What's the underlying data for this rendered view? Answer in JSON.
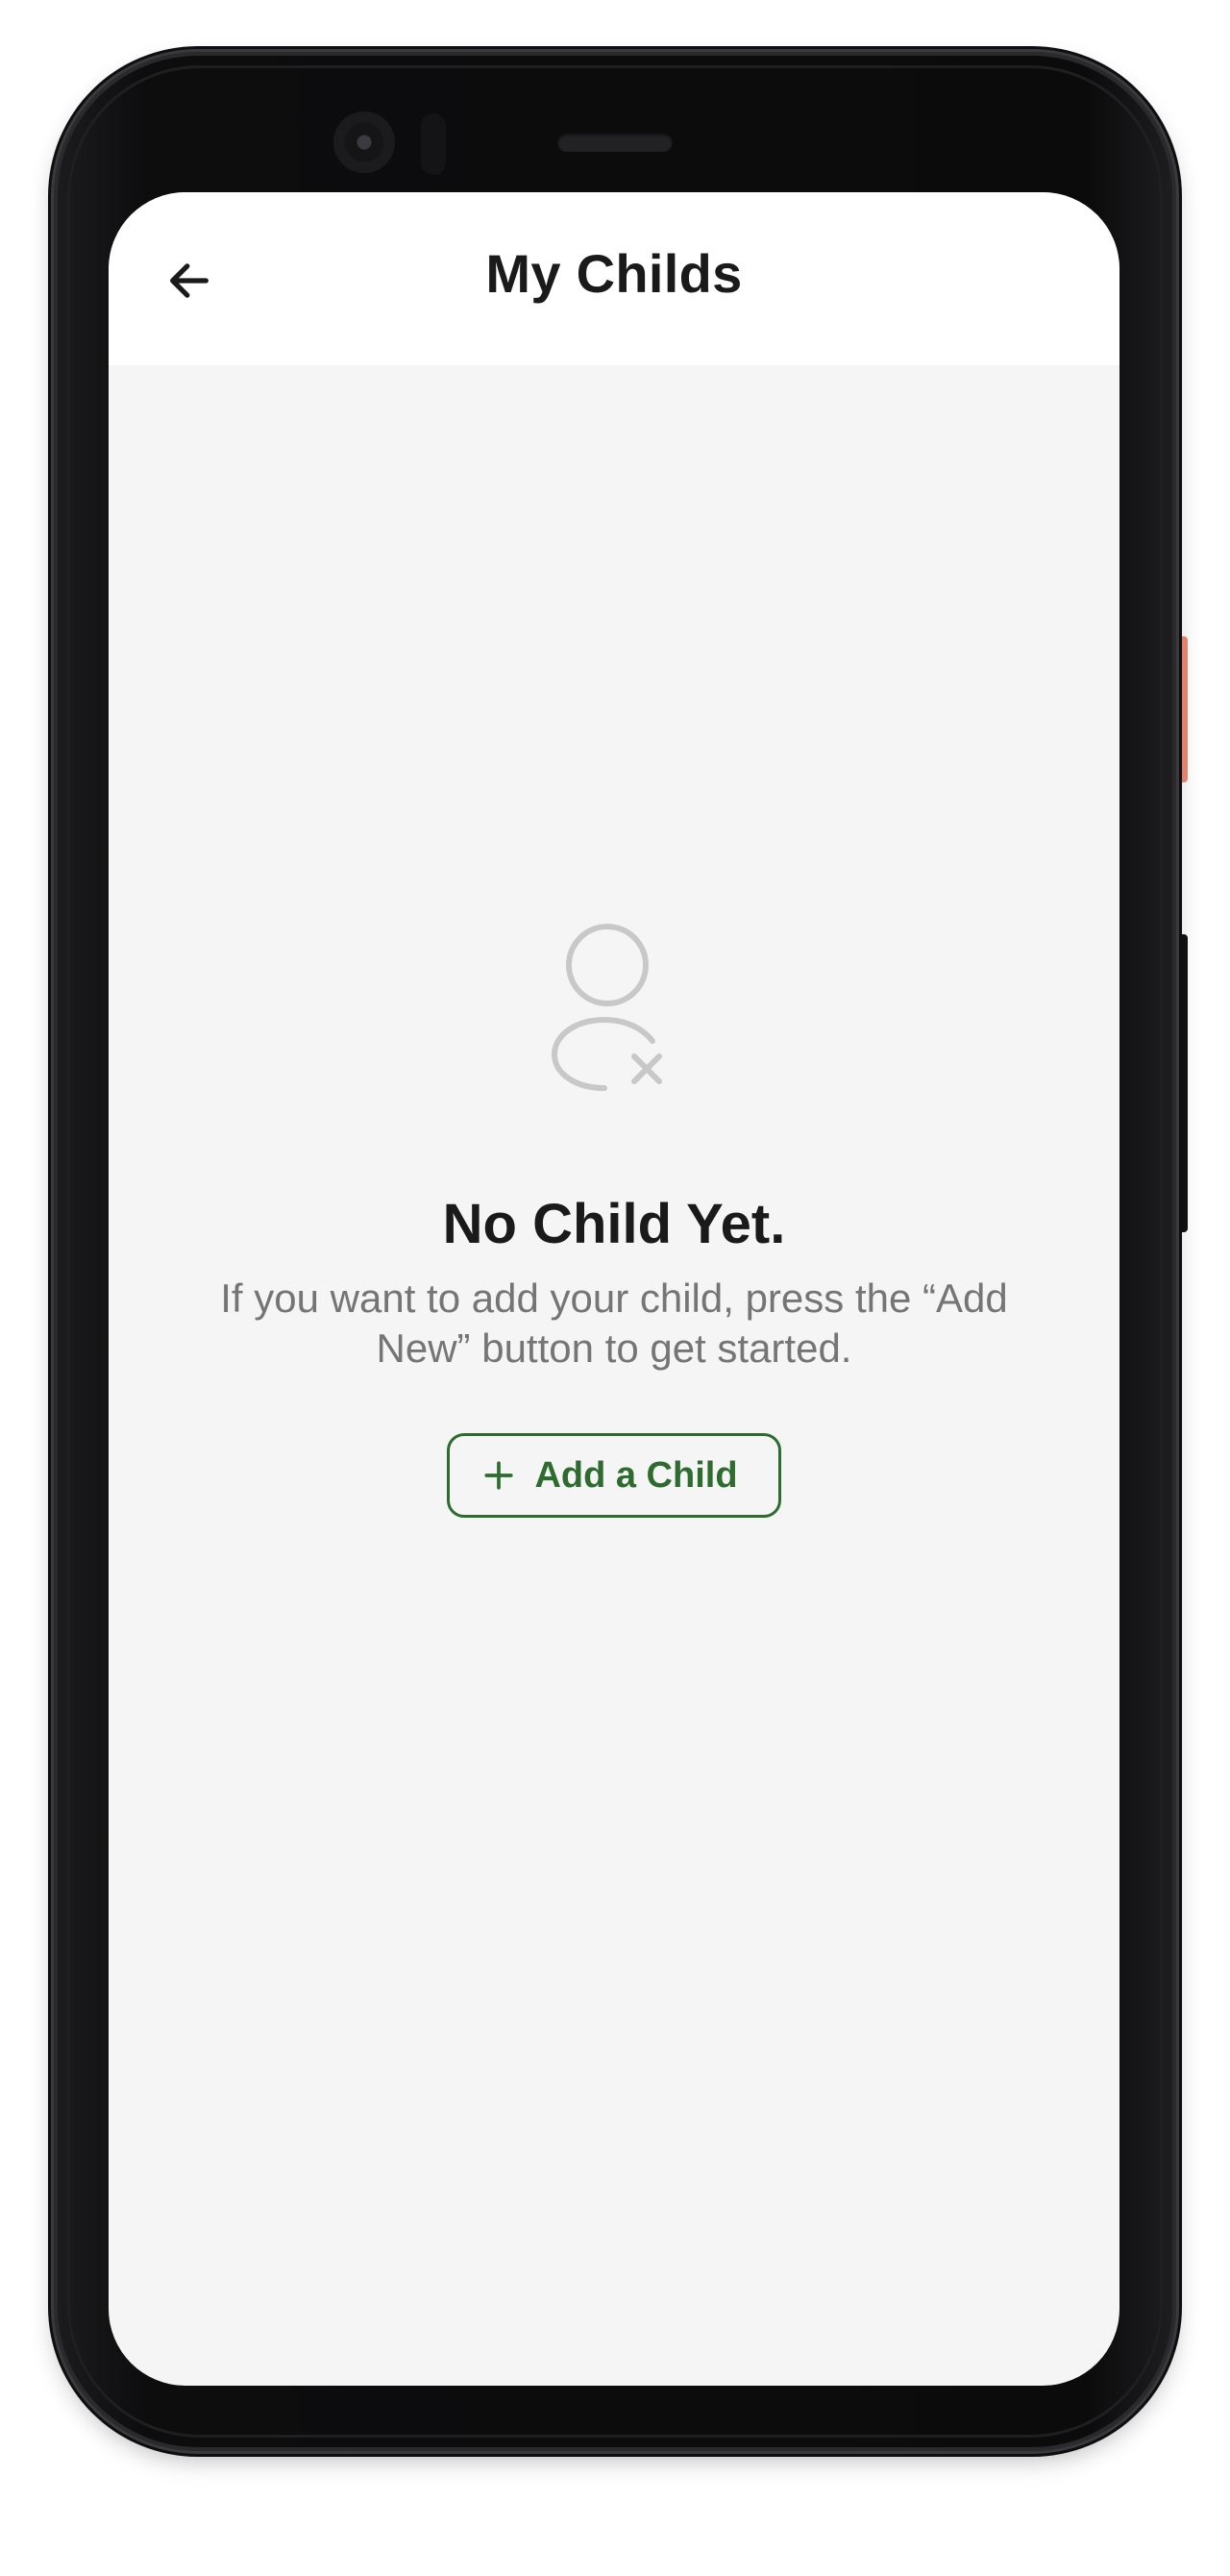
{
  "header": {
    "title": "My Childs",
    "back_icon": "arrow-left-icon"
  },
  "empty_state": {
    "icon": "user-remove-icon",
    "title": "No Child Yet.",
    "description": "If you want to add your child, press the “Add New” button to get started."
  },
  "actions": {
    "add_child_label": "Add a Child",
    "add_child_icon": "plus-icon"
  },
  "colors": {
    "accent": "#2e6b2f",
    "background": "#f5f5f5",
    "header_background": "#ffffff",
    "muted_text": "#757575",
    "icon_gray": "#c8c8c8"
  }
}
